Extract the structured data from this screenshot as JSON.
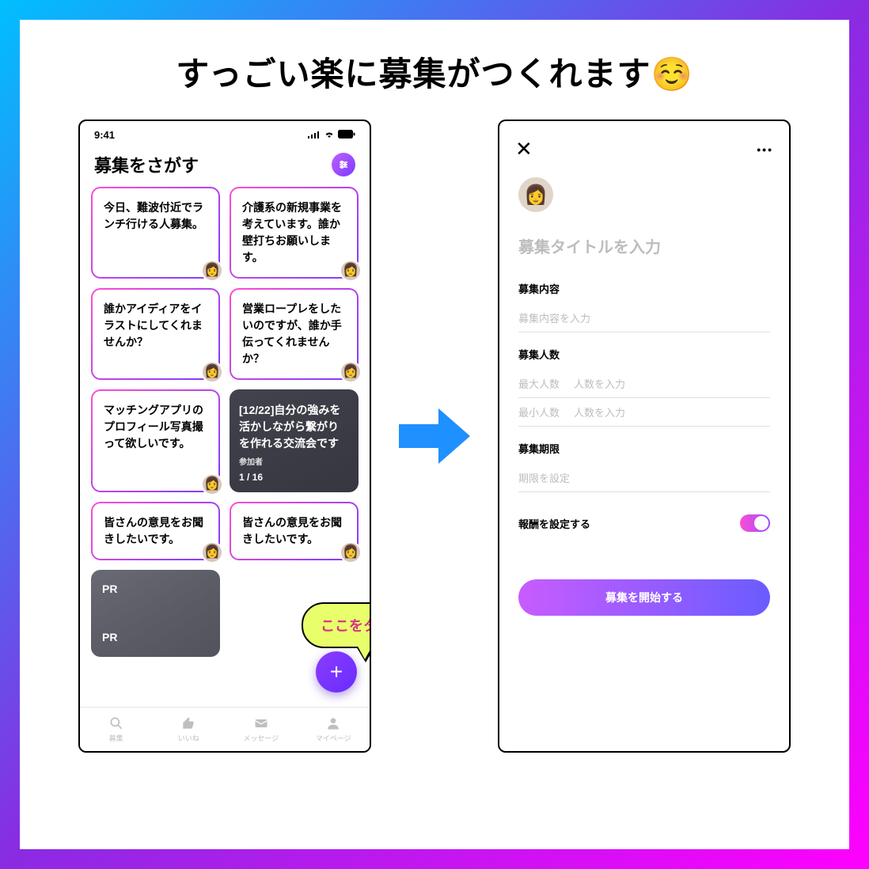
{
  "headline": "すっごい楽に募集がつくれます☺️",
  "left": {
    "statusTime": "9:41",
    "title": "募集をさがす",
    "cards": [
      "今日、難波付近でランチ行ける人募集。",
      "介護系の新規事業を考えています。誰か壁打ちお願いします。",
      "誰かアイディアをイラストにしてくれませんか？",
      "営業ロープレをしたいのですが、誰か手伝ってくれませんか？",
      "マッチングアプリのプロフィール写真撮って欲しいです。",
      "[12/22]自分の強みを活かしながら繋がりを作れる交流会です",
      "皆さんの意見をお聞きしたいです。",
      "皆さんの意見をお聞きしたいです。"
    ],
    "darkCard": {
      "participantsLabel": "参加者",
      "participantsCount": "1 / 16"
    },
    "prLabel": "PR",
    "bubble": "ここをタップ",
    "tabs": [
      "募集",
      "いいね",
      "メッセージ",
      "マイページ"
    ]
  },
  "right": {
    "titlePlaceholder": "募集タイトルを入力",
    "sections": {
      "contentLabel": "募集内容",
      "contentPlaceholder": "募集内容を入力",
      "countLabel": "募集人数",
      "maxLabel": "最大人数",
      "minLabel": "最小人数",
      "countPlaceholder": "人数を入力",
      "deadlineLabel": "募集期限",
      "deadlinePlaceholder": "期限を設定",
      "rewardLabel": "報酬を設定する"
    },
    "submit": "募集を開始する"
  }
}
